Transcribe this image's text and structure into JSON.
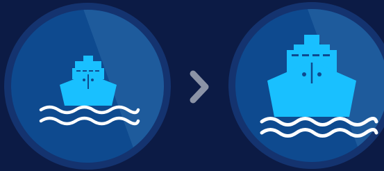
{
  "colors": {
    "background": "#0c1b45",
    "circle_ring": "#14336f",
    "circle_fill": "#0e4a8f",
    "circle_highlight": "#2b6aa8",
    "ship": "#19c0ff",
    "ship_detail": "#0e4a8f",
    "waves": "#ffffff",
    "arrow": "#8b93a6"
  },
  "icons": {
    "before": "ship-icon",
    "separator": "chevron-right-icon",
    "after": "ship-icon"
  }
}
